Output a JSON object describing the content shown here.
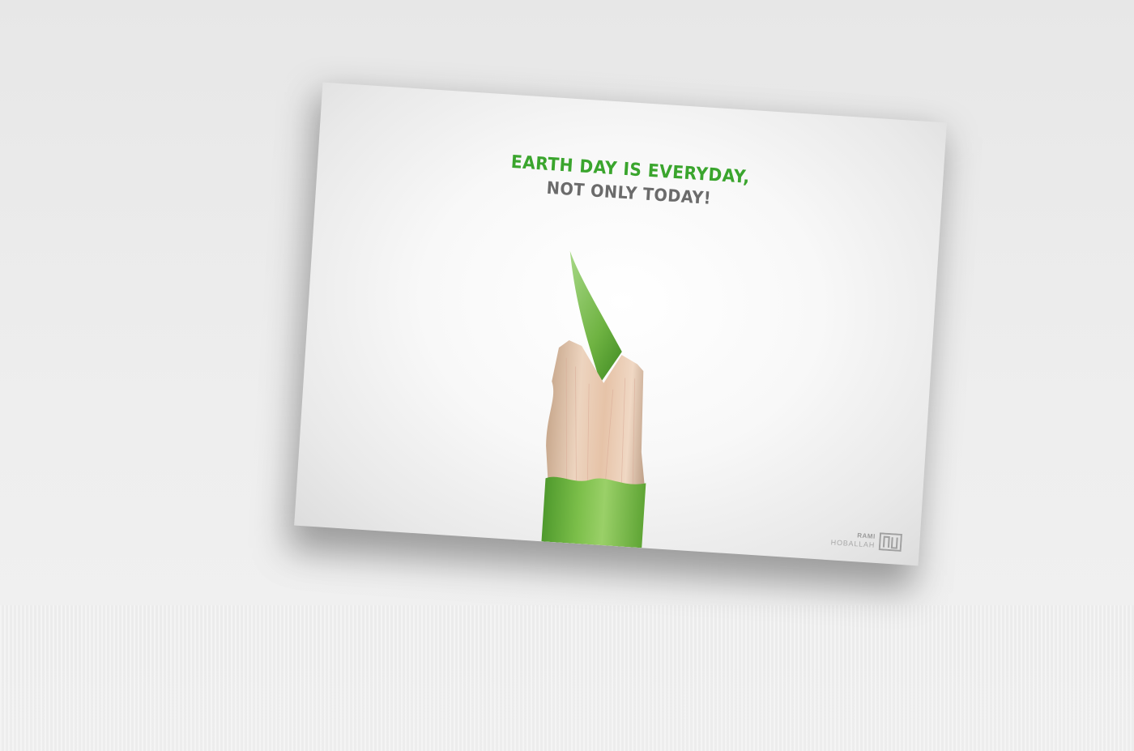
{
  "poster": {
    "headline_line1": "EARTH DAY IS EVERYDAY,",
    "headline_line2": "NOT ONLY TODAY!",
    "brand_first": "RAMI",
    "brand_last": "HOBALLAH"
  },
  "colors": {
    "headline_green": "#3aa52d",
    "headline_gray": "#6b6b6b",
    "pencil_green": "#7cbf4a",
    "wood": "#e2c2a6"
  },
  "icons": [
    "pencil-illustration",
    "rh-logo-icon"
  ]
}
